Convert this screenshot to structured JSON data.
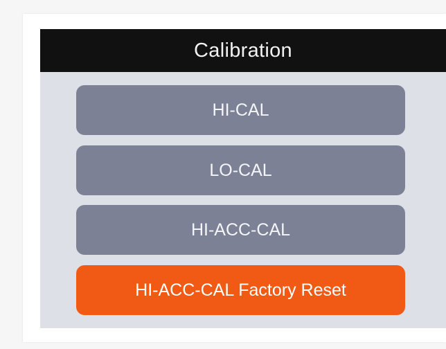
{
  "screen": {
    "title": "Calibration",
    "menu": [
      {
        "label": "HI-CAL",
        "color": "#7c8195"
      },
      {
        "label": "LO-CAL",
        "color": "#7c8195"
      },
      {
        "label": "HI-ACC-CAL",
        "color": "#7c8195"
      },
      {
        "label": "HI-ACC-CAL Factory Reset",
        "color": "#f05a14"
      }
    ]
  }
}
